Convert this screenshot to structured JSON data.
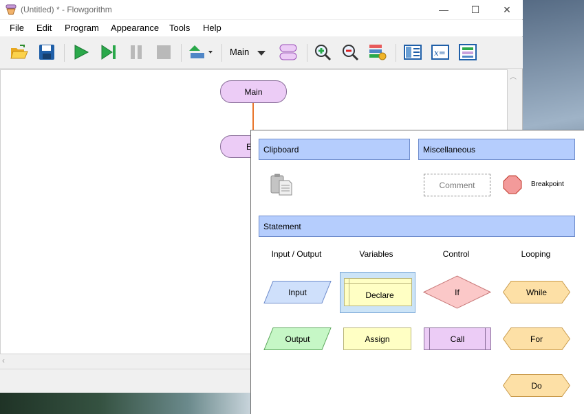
{
  "window": {
    "title": "(Untitled) * - Flowgorithm",
    "controls": {
      "minimize": "—",
      "maximize": "☐",
      "close": "✕"
    }
  },
  "menu": [
    "File",
    "Edit",
    "Program",
    "Appearance",
    "Tools",
    "Help"
  ],
  "toolbar": {
    "function_select": "Main",
    "icons": [
      "open-icon",
      "save-icon",
      "run-icon",
      "step-icon",
      "pause-icon",
      "stop-icon",
      "layout-icon",
      "function-icon",
      "zoom-in-icon",
      "zoom-out-icon",
      "style-icon",
      "panels-icon",
      "variables-icon",
      "console-icon"
    ]
  },
  "canvas": {
    "start_label": "Main",
    "end_label": "E"
  },
  "palette": {
    "sections": {
      "clipboard": "Clipboard",
      "misc": "Miscellaneous",
      "statement": "Statement"
    },
    "misc": {
      "comment": "Comment",
      "breakpoint": "Breakpoint"
    },
    "columns": [
      "Input / Output",
      "Variables",
      "Control",
      "Looping"
    ],
    "shapes": {
      "input": "Input",
      "output": "Output",
      "declare": "Declare",
      "assign": "Assign",
      "if": "If",
      "call": "Call",
      "while": "While",
      "for": "For",
      "do": "Do"
    }
  },
  "colors": {
    "section_bg": "#b5cdfd",
    "terminal": "#ecccf6",
    "input": "#cfe0fb",
    "output": "#c6f7c6",
    "declare": "#ffffc4",
    "if": "#fbc8c8",
    "loop": "#fde0a6",
    "flow_line": "#e8742a",
    "breakpoint": "#f39a9a"
  }
}
